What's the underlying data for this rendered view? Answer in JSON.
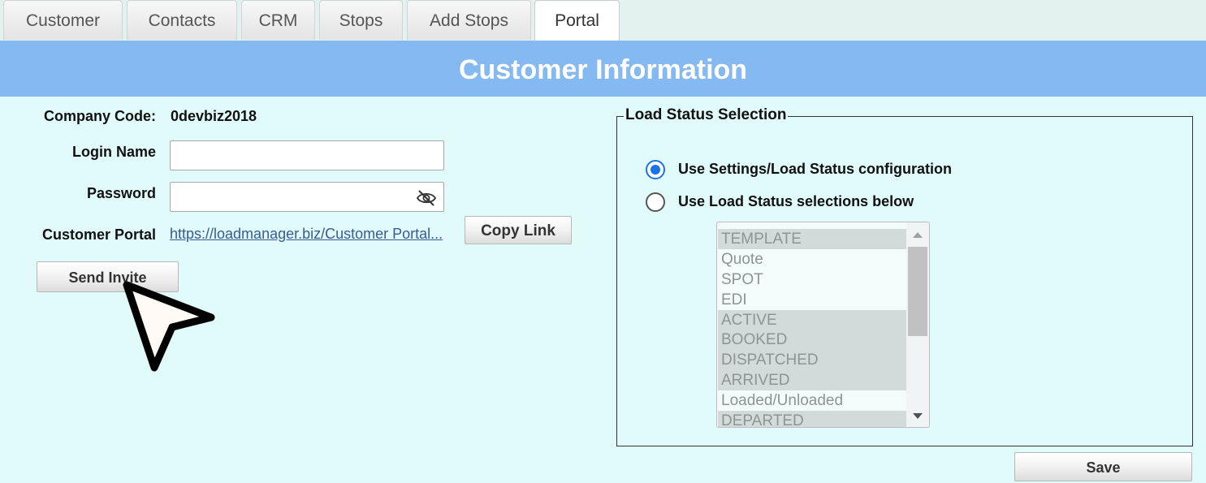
{
  "tabs": [
    {
      "label": "Customer",
      "active": false
    },
    {
      "label": "Contacts",
      "active": false
    },
    {
      "label": "CRM",
      "active": false
    },
    {
      "label": "Stops",
      "active": false
    },
    {
      "label": "Add Stops",
      "active": false
    },
    {
      "label": "Portal",
      "active": true
    }
  ],
  "header": {
    "title": "Customer Information"
  },
  "form": {
    "company_code_label": "Company Code:",
    "company_code_value": "0devbiz2018",
    "login_name_label": "Login Name",
    "login_name_value": "",
    "password_label": "Password",
    "password_value": "",
    "password_toggle_icon": "eye-slash-icon",
    "customer_portal_label": "Customer Portal",
    "customer_portal_link": "https://loadmanager.biz/Customer Portal...",
    "copy_link_label": "Copy Link",
    "send_invite_label": "Send Invite"
  },
  "load_status": {
    "legend": "Load Status Selection",
    "radio_settings_label": "Use Settings/Load Status configuration",
    "radio_settings_checked": true,
    "radio_below_label": "Use Load Status selections below",
    "radio_below_checked": false,
    "options": [
      {
        "label": "TEMPLATE",
        "selected": true
      },
      {
        "label": "Quote",
        "selected": false
      },
      {
        "label": "SPOT",
        "selected": false
      },
      {
        "label": "EDI",
        "selected": false
      },
      {
        "label": "ACTIVE",
        "selected": true
      },
      {
        "label": "BOOKED",
        "selected": true
      },
      {
        "label": "DISPATCHED",
        "selected": true
      },
      {
        "label": "ARRIVED",
        "selected": true
      },
      {
        "label": "Loaded/Unloaded",
        "selected": false
      },
      {
        "label": "DEPARTED",
        "selected": true
      }
    ]
  },
  "save_label": "Save",
  "colors": {
    "header_bg": "#85b9f2",
    "page_bg": "#e1fafa",
    "radio_accent": "#1a73e8",
    "link": "#375b94"
  }
}
